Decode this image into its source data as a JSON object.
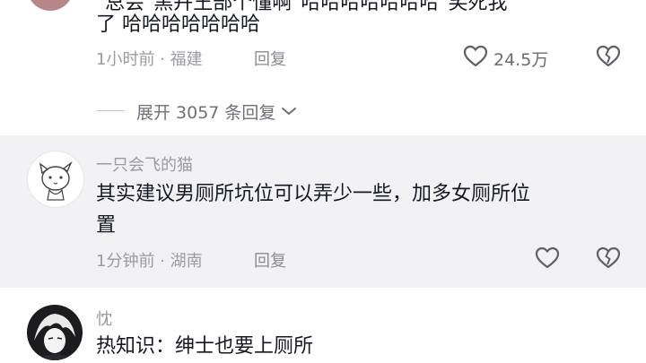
{
  "comment1": {
    "text_line1": "\"总会\"黑卉王部个懂啊\"哈哈哈哈哈哈哈\"笑死我",
    "text_line2": "了 哈哈哈哈哈哈哈",
    "time_location": "1小时前 · 福建",
    "reply_label": "回复",
    "like_count": "24.5万",
    "expand_label": "展开 3057 条回复"
  },
  "comment2": {
    "username": "一只会飞的猫",
    "text_line1": "其实建议男厕所坑位可以弄少一些，加多女厕所位",
    "text_line2": "置",
    "time_location": "1分钟前 · 湖南",
    "reply_label": "回复",
    "highlight_color": "#f2f2f4"
  },
  "comment3": {
    "username": "忱",
    "text_line1": "热知识：绅士也要上厕所"
  },
  "icons": {
    "like": "heart-icon",
    "dislike": "broken-heart-icon",
    "expand": "chevron-down-icon"
  }
}
